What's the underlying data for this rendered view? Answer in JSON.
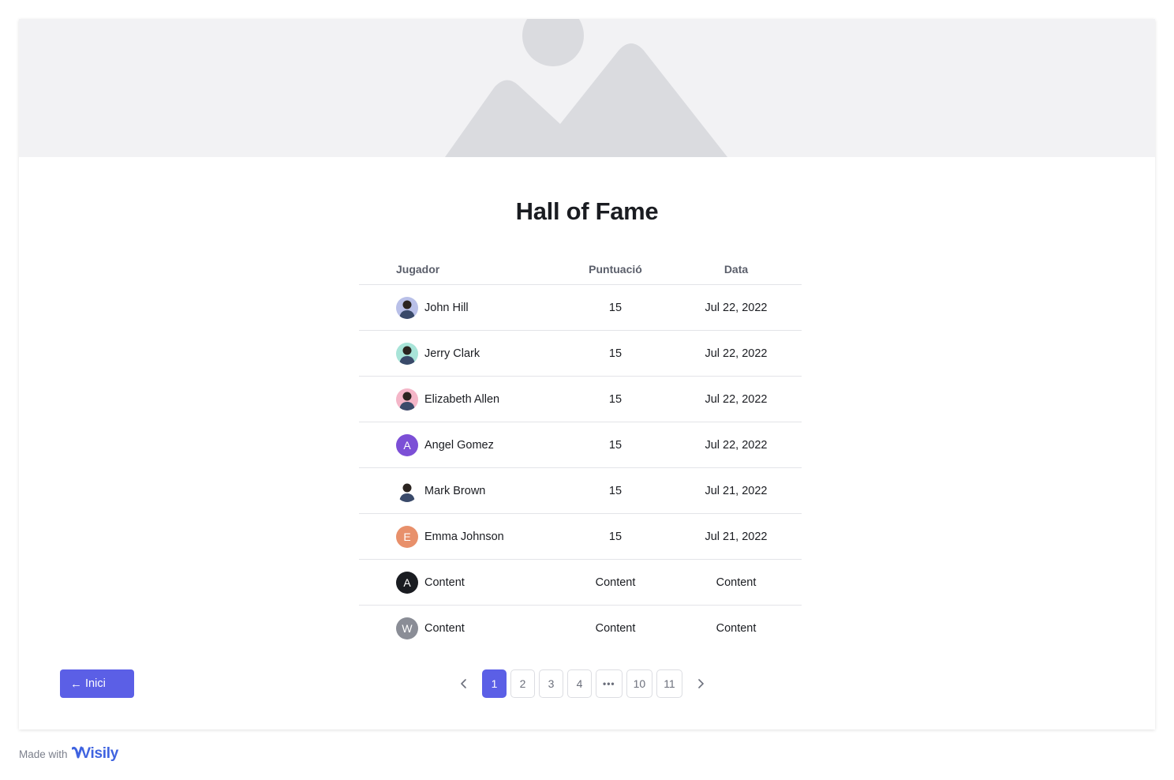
{
  "page": {
    "title": "Hall of Fame"
  },
  "table": {
    "headers": {
      "player": "Jugador",
      "score": "Puntuació",
      "date": "Data"
    },
    "rows": [
      {
        "name": "John Hill",
        "score": "15",
        "date": "Jul 22, 2022",
        "avatar": {
          "type": "photo",
          "bg": "#b9c0e8"
        }
      },
      {
        "name": "Jerry Clark",
        "score": "15",
        "date": "Jul 22, 2022",
        "avatar": {
          "type": "photo",
          "bg": "#a8e4d8"
        }
      },
      {
        "name": "Elizabeth Allen",
        "score": "15",
        "date": "Jul 22, 2022",
        "avatar": {
          "type": "photo",
          "bg": "#f4b6c8"
        }
      },
      {
        "name": "Angel Gomez",
        "score": "15",
        "date": "Jul 22, 2022",
        "avatar": {
          "type": "initial",
          "initial": "A",
          "bg": "#7c4fd6"
        }
      },
      {
        "name": "Mark Brown",
        "score": "15",
        "date": "Jul 21, 2022",
        "avatar": {
          "type": "photo",
          "bg": "#ffffff"
        }
      },
      {
        "name": "Emma Johnson",
        "score": "15",
        "date": "Jul 21, 2022",
        "avatar": {
          "type": "initial",
          "initial": "E",
          "bg": "#e8906b"
        }
      },
      {
        "name": "Content",
        "score": "Content",
        "date": "Content",
        "avatar": {
          "type": "initial",
          "initial": "A",
          "bg": "#1a1c21"
        }
      },
      {
        "name": "Content",
        "score": "Content",
        "date": "Content",
        "avatar": {
          "type": "initial",
          "initial": "W",
          "bg": "#8a8d96"
        }
      }
    ]
  },
  "pagination": {
    "prev_icon": "chevron-left-icon",
    "next_icon": "chevron-right-icon",
    "pages": [
      "1",
      "2",
      "3",
      "4",
      "•••",
      "10",
      "11"
    ],
    "current": "1"
  },
  "back_button": {
    "label": "Inici",
    "icon": "arrow-left-icon"
  },
  "footer": {
    "made_with": "Made with",
    "brand": "Visily"
  },
  "colors": {
    "accent": "#5b5fe6",
    "hero_bg": "#f2f2f4",
    "placeholder_shape": "#dadbdf"
  }
}
